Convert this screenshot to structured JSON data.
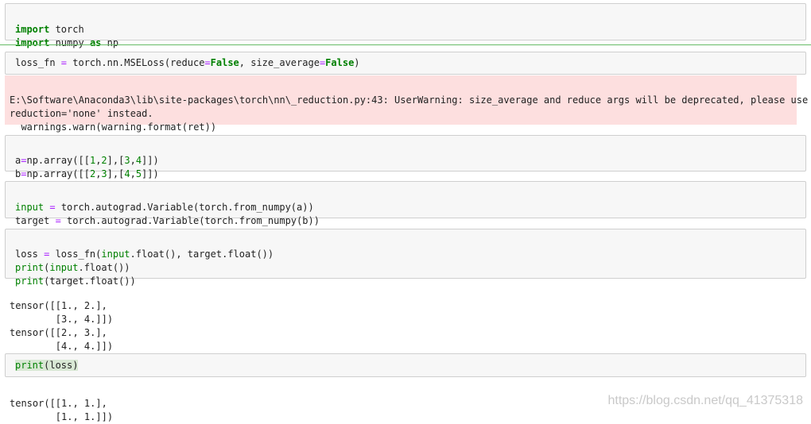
{
  "cells": [
    {
      "input_lines": [
        "import torch",
        "import numpy as np"
      ]
    },
    {
      "input_lines": [
        "loss_fn = torch.nn.MSELoss(reduce=False, size_average=False)"
      ],
      "error_output": [
        "E:\\Software\\Anaconda3\\lib\\site-packages\\torch\\nn\\_reduction.py:43: UserWarning: size_average and reduce args will be deprecated, please use",
        "reduction='none' instead.",
        "  warnings.warn(warning.format(ret))"
      ]
    },
    {
      "input_lines": [
        "a=np.array([[1,2],[3,4]])",
        "b=np.array([[2,3],[4,5]])"
      ]
    },
    {
      "input_lines": [
        "input = torch.autograd.Variable(torch.from_numpy(a))",
        "target = torch.autograd.Variable(torch.from_numpy(b))"
      ]
    },
    {
      "input_lines": [
        "loss = loss_fn(input.float(), target.float())",
        "print(input.float())",
        "print(target.float())"
      ],
      "output": [
        "tensor([[1., 2.],",
        "        [3., 4.]])",
        "tensor([[2., 3.],",
        "        [4., 4.]])"
      ]
    },
    {
      "input_lines": [
        "print(loss)"
      ],
      "output": [
        "tensor([[1., 1.],",
        "        [1., 1.]])"
      ]
    }
  ],
  "watermark": "https://blog.csdn.net/qq_41375318",
  "colors": {
    "cell_background": "#f7f7f7",
    "cell_border": "#cfcfcf",
    "error_background": "#fddfdf",
    "keyword": "#008000",
    "selected_divider": "#66bb66"
  }
}
